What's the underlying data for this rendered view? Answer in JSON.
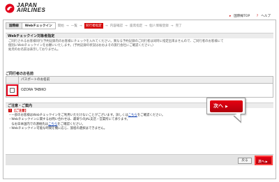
{
  "header": {
    "brand_line1": "JAPAN",
    "brand_line2": "AIRLINES",
    "links": [
      "国際線TOP",
      "ヘルプ"
    ],
    "logo_color": "#e2001a"
  },
  "steps": {
    "tab1": "国際線",
    "tab2": "Webチェックイン",
    "items": [
      "開始",
      "一覧",
      "同行者指定",
      "内容確認",
      "座席指定",
      "個人情報登録",
      "完了"
    ],
    "current_index": 2,
    "accent": "#d40000"
  },
  "section": {
    "title": "Webチェックイン対象者指定",
    "notice_lines": [
      "ご同行されるお客様同行(予約記録内のお客様にチェックを入れてください。異なる予約記録のご同行者は同時に指定出来ませんので、ご同行者のお客様にて",
      "個別にWebチェックインをお願いいたします。(予約記録の状況はおおよその旅行会社にご確認ください。)",
      "幼児のお名前は表示しておりません。"
    ]
  },
  "companion": {
    "title": "ご同行者のお名前",
    "col_header": "パスポートのお名前",
    "rows": [
      {
        "name": "OZORA TABIKO",
        "checked": false
      }
    ]
  },
  "notes": {
    "title": "ご注意・ご案内",
    "subtitle": "【ご注意】",
    "lines": [
      "・一部のお客様はWebチェックインをご利用いただけないことがございます。詳しくは",
      "・Webチェックインに関するお問い合わせは、最寄りのJAL支店・営業所にて承ります。",
      "　なお日本国内での連絡先は",
      "・Webチェックイン可能な時間を機に応じ、旅程の選択はできません。"
    ],
    "link1": "こちら",
    "link1_suffix": "をご確認ください。",
    "link2": "JAL支店・営業所",
    "link3": "こちら",
    "link3_suffix": "をご確認ください。"
  },
  "callout": {
    "label": "次へ"
  },
  "footer": {
    "back_label": "戻る",
    "next_label": "次へ"
  }
}
